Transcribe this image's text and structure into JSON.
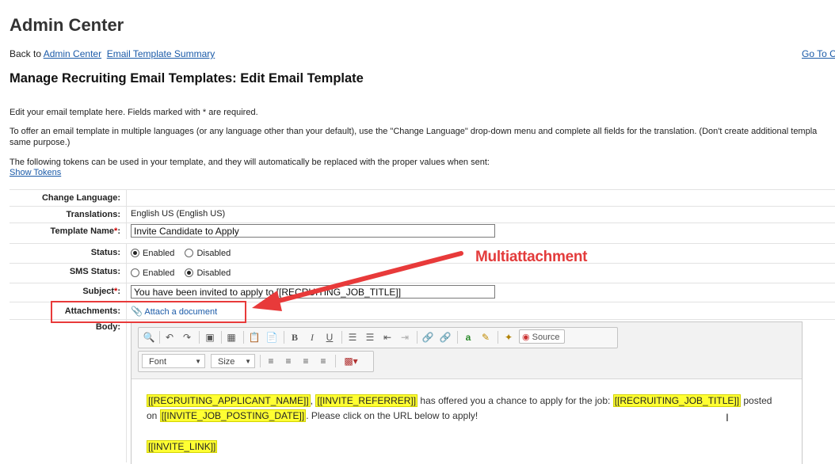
{
  "header": {
    "title": "Admin Center",
    "back_prefix": "Back to",
    "back_link": "Admin Center",
    "summary_link": "Email Template Summary",
    "goto_link": "Go To C",
    "section_title": "Manage Recruiting Email Templates: Edit Email Template"
  },
  "intro": {
    "required_note": "Edit your email template here. Fields marked with * are required.",
    "multilang_note": "To offer an email template in multiple languages (or any language other than your default), use the \"Change Language\" drop-down menu and complete all fields for the translation. (Don't create additional templa same purpose.)",
    "tokens_note": "The following tokens can be used in your template, and they will automatically be replaced with the proper values when sent:",
    "show_tokens": "Show Tokens"
  },
  "form": {
    "change_language_label": "Change Language:",
    "translations_label": "Translations:",
    "translations_value": "English US (English US)",
    "template_name_label": "Template Name",
    "template_name_value": "Invite Candidate to Apply",
    "status_label": "Status:",
    "status_options": [
      "Enabled",
      "Disabled"
    ],
    "status_selected": "Enabled",
    "sms_status_label": "SMS Status:",
    "sms_options": [
      "Enabled",
      "Disabled"
    ],
    "sms_selected": "Disabled",
    "subject_label": "Subject",
    "subject_value": "You have been invited to apply to [[RECRUITING_JOB_TITLE]]",
    "attachments_label": "Attachments:",
    "attach_link": "Attach a document",
    "body_label": "Body:",
    "required_mark": "*",
    "colon": ":"
  },
  "editor": {
    "source_label": "Source",
    "font_combo": "Font",
    "size_combo": "Size",
    "body": {
      "token_applicant": "[[RECRUITING_APPLICANT_NAME]]",
      "sep1": ", ",
      "token_referrer": "[[INVITE_REFERRER]]",
      "text1": " has offered you a chance to apply for the job: ",
      "token_job_title": "[[RECRUITING_JOB_TITLE]]",
      "text2": " posted",
      "text3": "on ",
      "token_posting_date": "[[INVITE_JOB_POSTING_DATE]]",
      "text4": ". Please click on the URL below to apply!",
      "token_link": "[[INVITE_LINK]]"
    }
  },
  "annotation": {
    "label": "Multiattachment",
    "color": "#e33b3b"
  }
}
